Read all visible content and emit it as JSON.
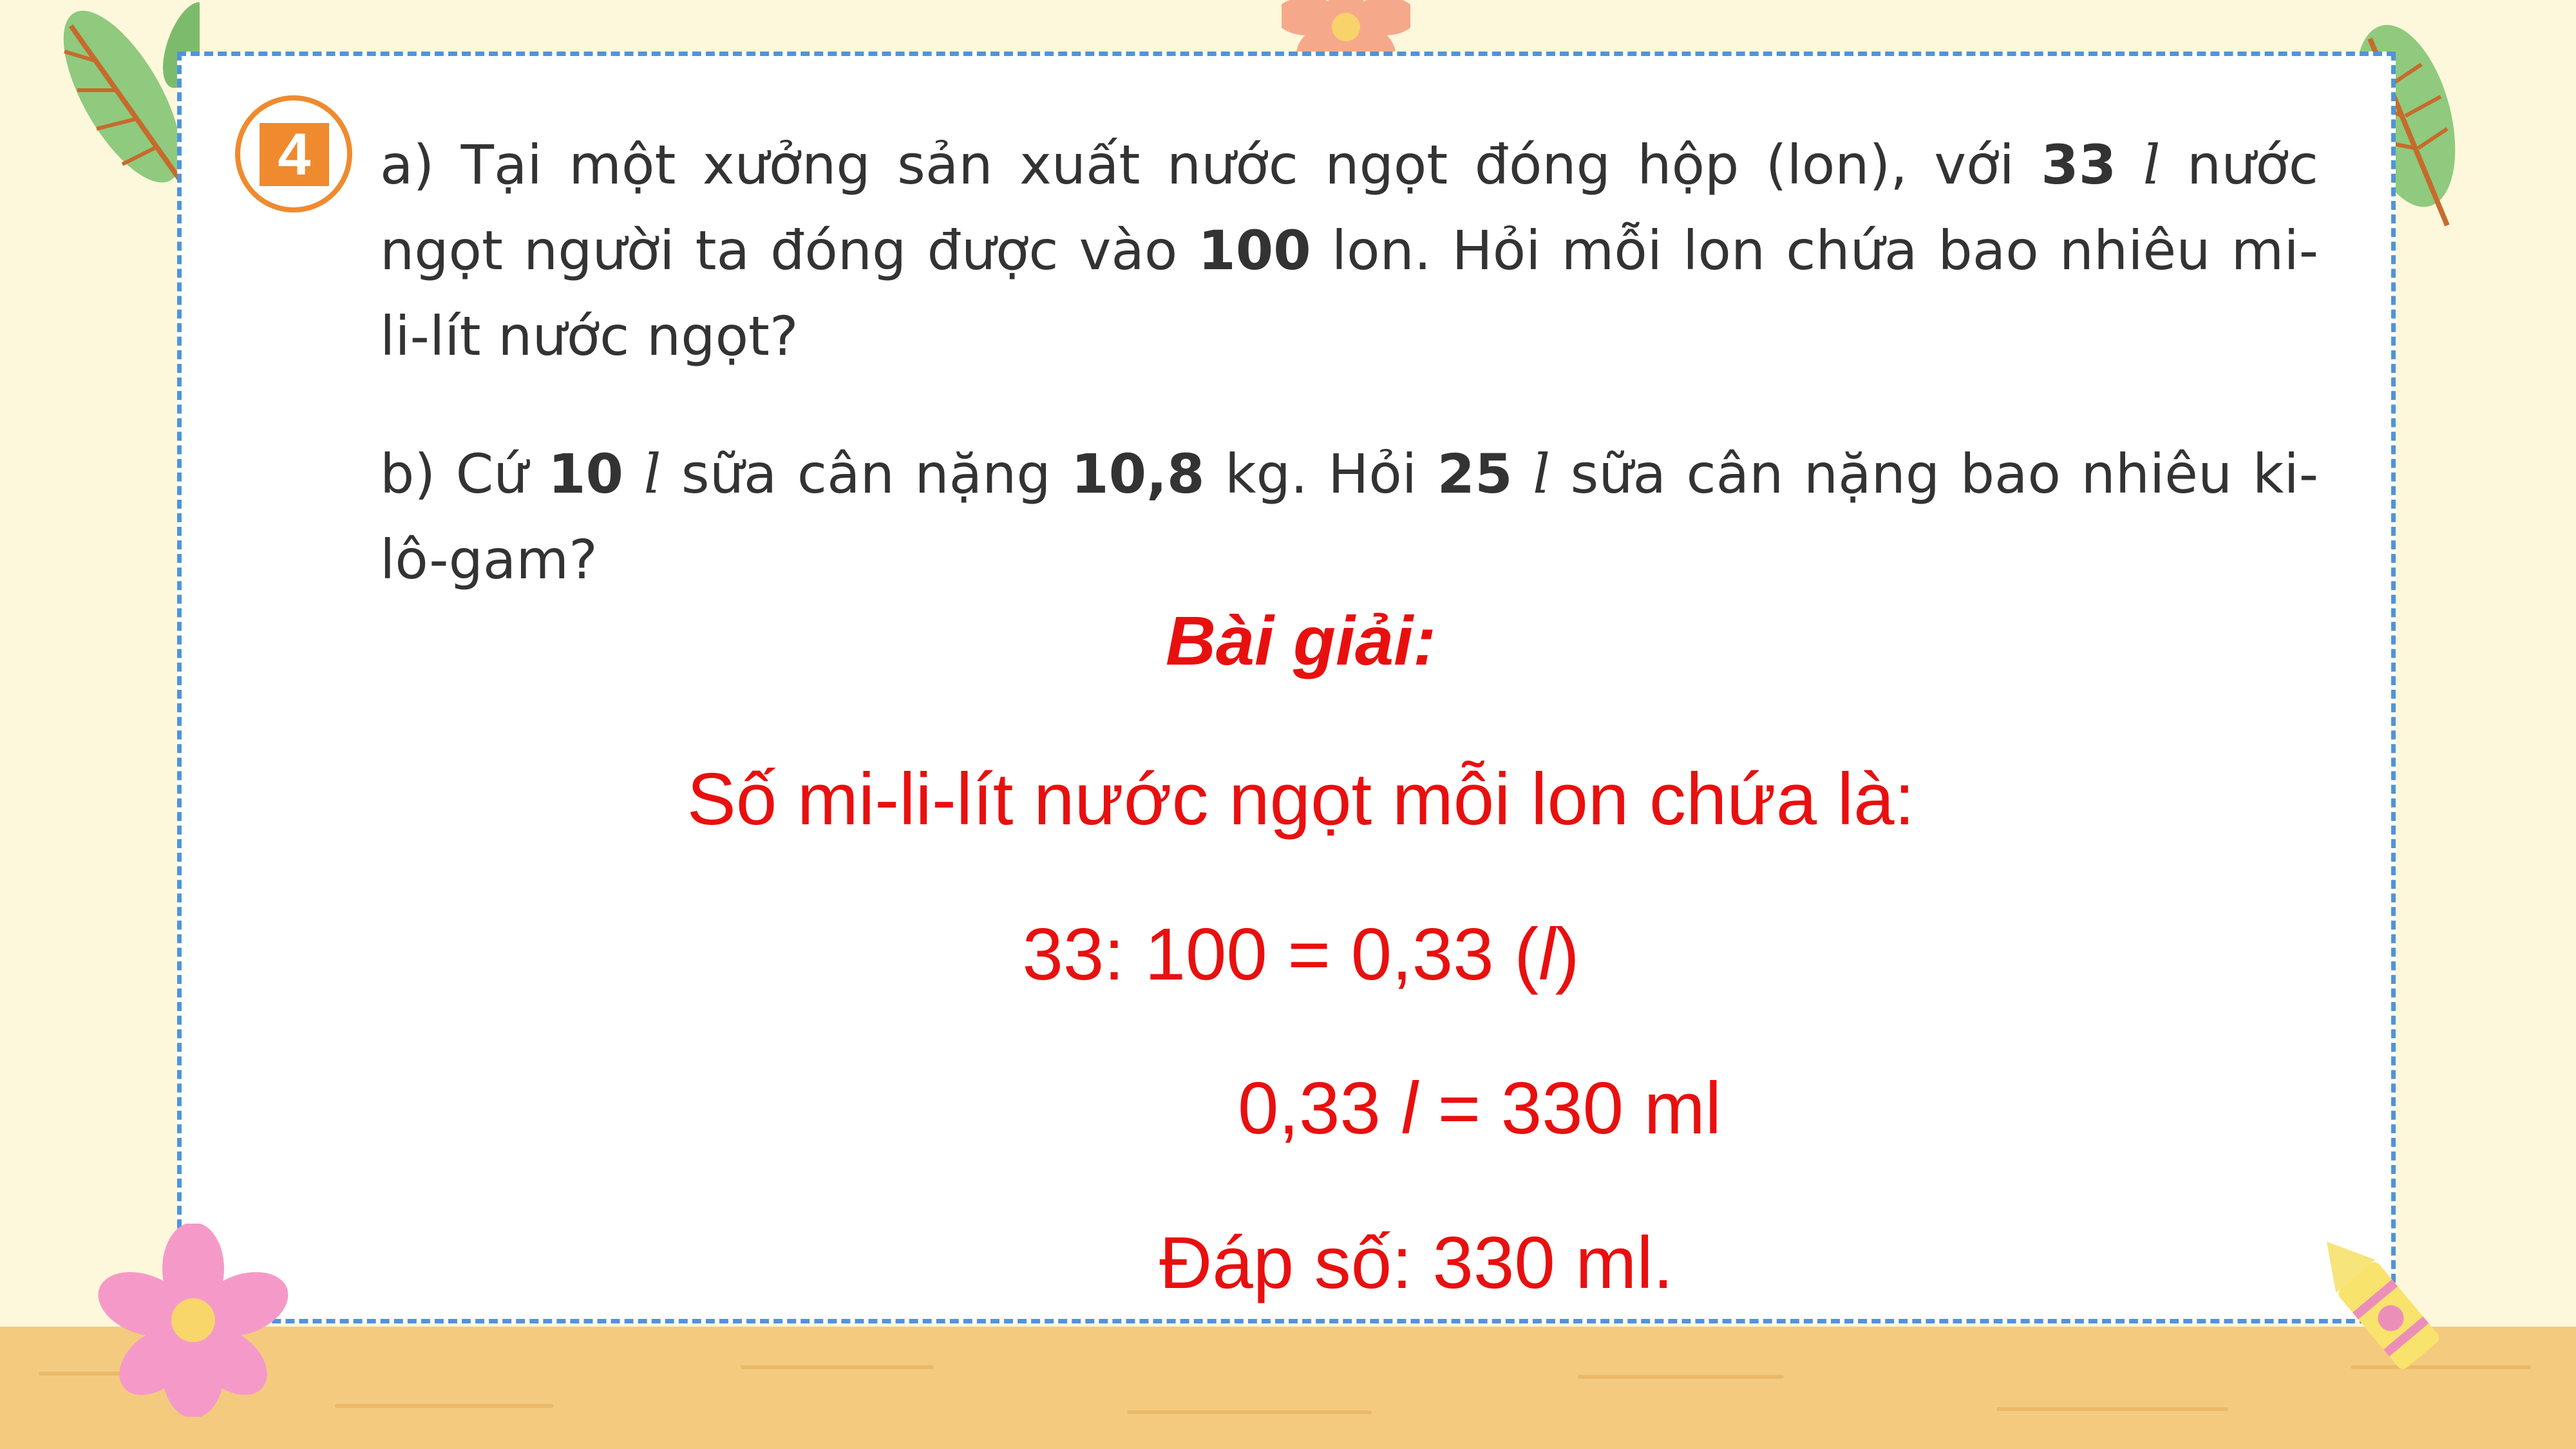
{
  "problem": {
    "number": "4",
    "part_a": {
      "t1": "a) Tại một xưởng sản xuất nước ngọt đóng hộp (lon), với ",
      "n1": "33",
      "u1": "l",
      "t2": " nước ngọt người ta đóng được vào ",
      "n2": "100",
      "t3": " lon. Hỏi mỗi lon chứa bao nhiêu mi-li-lít nước ngọt?"
    },
    "part_b": {
      "t1": "b) Cứ ",
      "n1": "10",
      "u1": "l",
      "t2": " sữa cân nặng ",
      "n2": "10,8",
      "t3": " kg. Hỏi ",
      "n3": "25",
      "u2": "l",
      "t4": " sữa cân nặng bao nhiêu ki-lô-gam?"
    }
  },
  "solution": {
    "title": "Bài giải:",
    "line1": "Số mi-li-lít nước ngọt mỗi lon chứa là:",
    "line2_pre": "33: 100 = 0,33 (",
    "line2_unit": "l",
    "line2_post": ")",
    "line3_pre": "0,33 ",
    "line3_unit": "l",
    "line3_post": " = 330 ml",
    "answer": "Đáp số: 330 ml."
  },
  "colors": {
    "answer_red": "#e8100f",
    "badge_orange": "#f08a2e",
    "dashed_border": "#4f95d8",
    "background": "#fdf7dc",
    "floor": "#f4cb7e"
  },
  "decorations": [
    "leaf-icon",
    "flower-icon",
    "crayon-icon"
  ]
}
